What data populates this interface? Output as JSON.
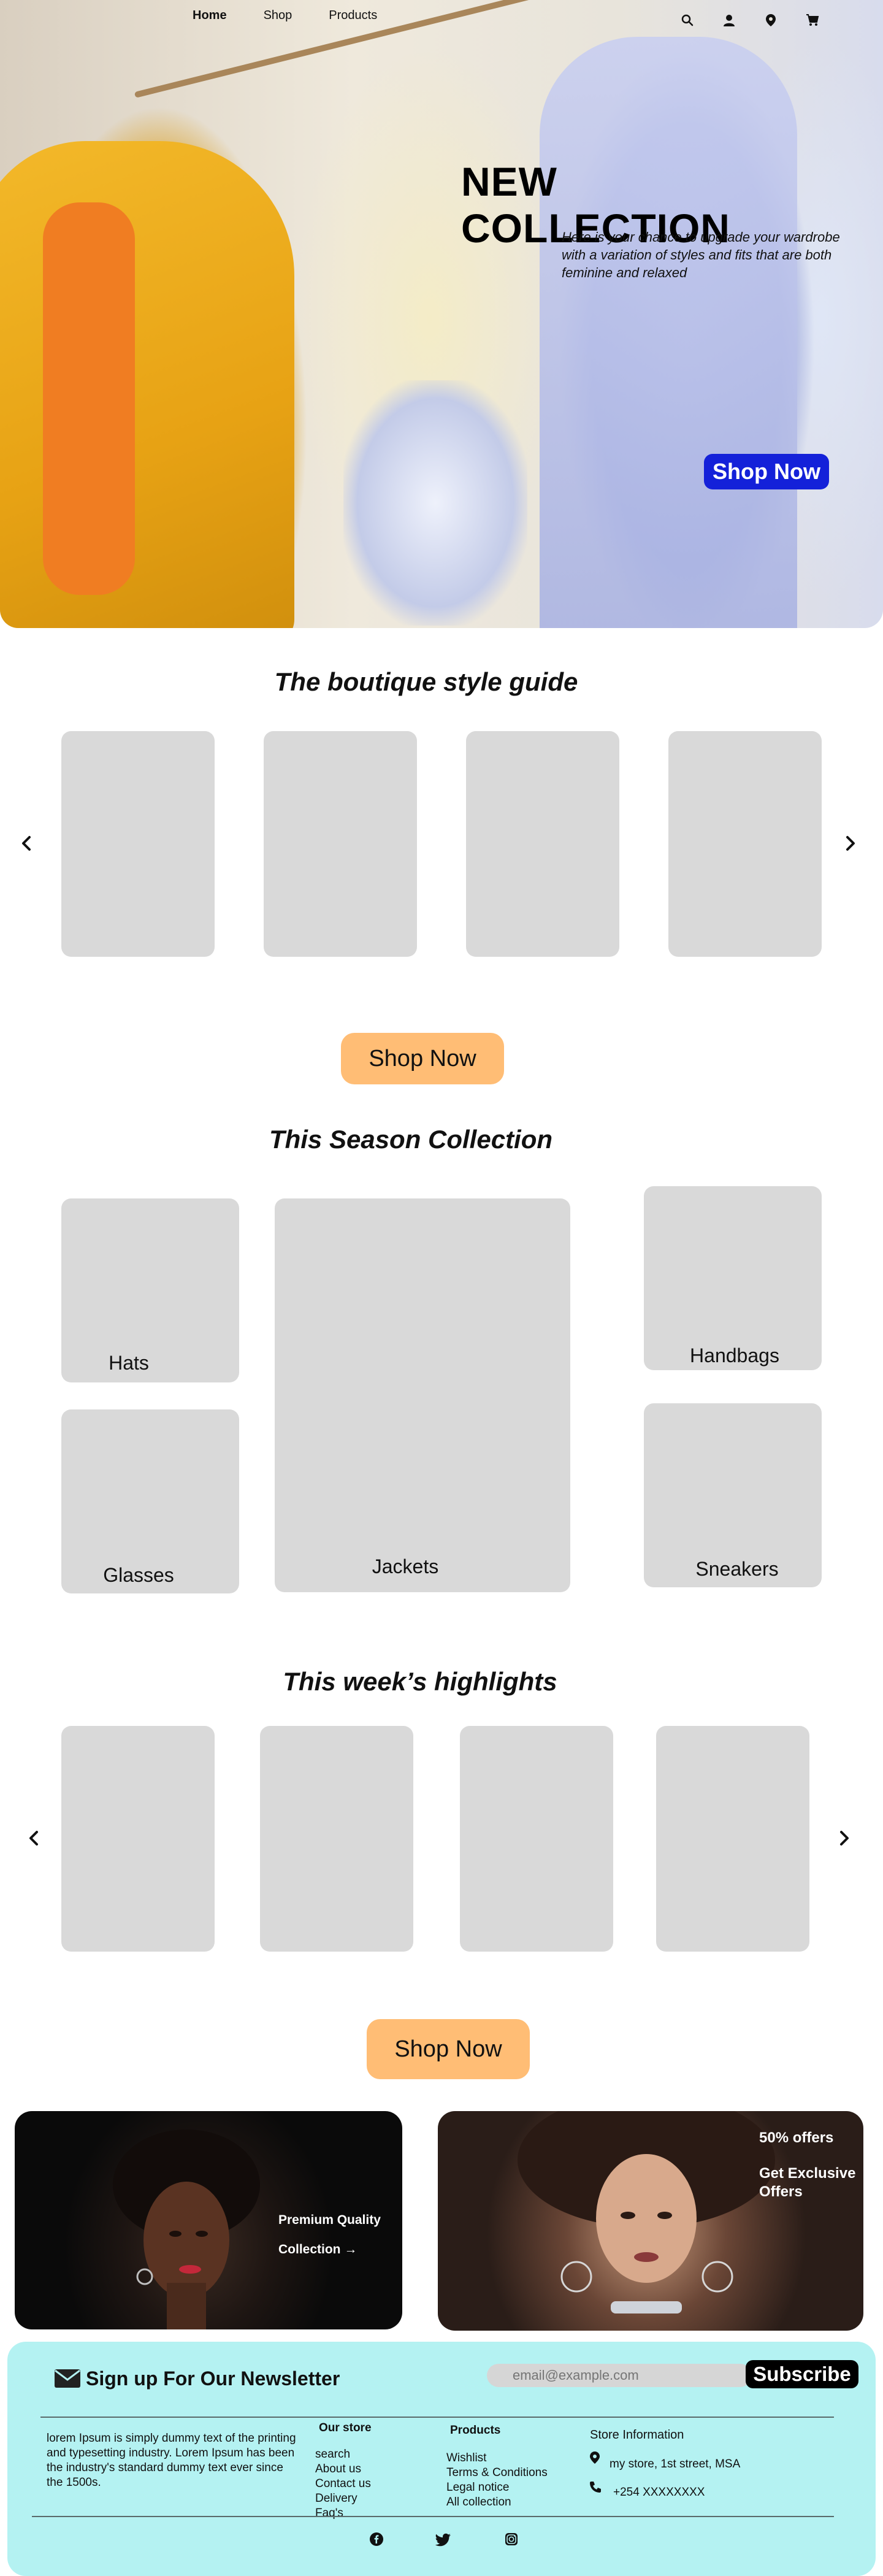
{
  "nav": {
    "items": [
      "Home",
      "Shop",
      "Products"
    ],
    "icons": [
      "search-icon",
      "user-icon",
      "location-icon",
      "cart-icon"
    ]
  },
  "hero": {
    "title": "NEW COLLECTION",
    "subtitle": "Here is your chance to upgrade your wardrobe with a variation of styles and fits that are both feminine and relaxed",
    "button": "Shop Now"
  },
  "style_guide": {
    "title": "The boutique style guide",
    "button": "Shop Now"
  },
  "season": {
    "title": "This Season Collection",
    "items": [
      "Hats",
      "Glasses",
      "Jackets",
      "Handbags",
      "Sneakers"
    ]
  },
  "highlights": {
    "title": "This week’s highlights",
    "button": "Shop Now"
  },
  "promo": {
    "left_line1": "Premium Quality",
    "left_line2": "Collection →",
    "right_line1": "50% offers",
    "right_line2": "Get Exclusive",
    "right_line3": "Offers"
  },
  "newsletter": {
    "title": "Sign up For Our Newsletter",
    "placeholder": "email@example.com",
    "button": "Subscribe"
  },
  "footer": {
    "about": "lorem Ipsum is simply dummy text of the printing and typesetting industry. Lorem Ipsum has been the industry's standard dummy text ever since the 1500s.",
    "store_head": "Our store",
    "store_links": [
      "search",
      "About us",
      "Contact us",
      "Delivery",
      "Faq's"
    ],
    "products_head": "Products",
    "products_links": [
      "Wishlist",
      "Terms & Conditions",
      "Legal notice",
      "All collection"
    ],
    "info_head": "Store Information",
    "address": "my store, 1st street, MSA",
    "phone": "+254 XXXXXXXX",
    "social_icons": [
      "facebook-icon",
      "twitter-icon",
      "instagram-icon"
    ]
  },
  "colors": {
    "accent_blue": "#1421d9",
    "button_orange": "#ffbd75",
    "footer_bg": "#b4f2f2",
    "card_gray": "#d9d9d9"
  }
}
